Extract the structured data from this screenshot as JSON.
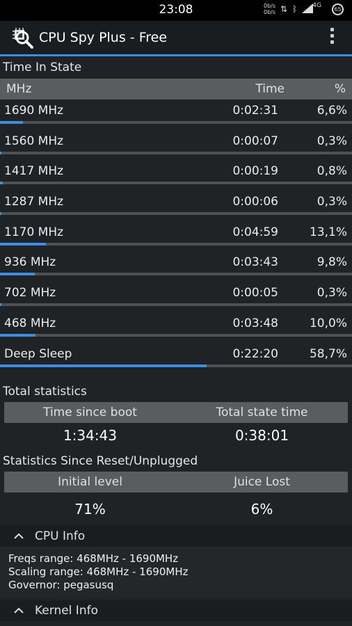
{
  "status": {
    "time": "23:08",
    "net_up": "0b/s",
    "net_down": "0b/s",
    "network": "4G",
    "battery": "65"
  },
  "app": {
    "title": "CPU Spy Plus - Free"
  },
  "time_in_state": {
    "title": "Time In State",
    "headers": {
      "mhz": "MHz",
      "time": "Time",
      "pct": "%"
    },
    "rows": [
      {
        "freq": "1690 MHz",
        "time": "0:02:31",
        "pct": "6,6%",
        "fill": 0.066
      },
      {
        "freq": "1560 MHz",
        "time": "0:00:07",
        "pct": "0,3%",
        "fill": 0.003
      },
      {
        "freq": "1417 MHz",
        "time": "0:00:19",
        "pct": "0,8%",
        "fill": 0.008
      },
      {
        "freq": "1287 MHz",
        "time": "0:00:06",
        "pct": "0,3%",
        "fill": 0.003
      },
      {
        "freq": "1170 MHz",
        "time": "0:04:59",
        "pct": "13,1%",
        "fill": 0.131
      },
      {
        "freq": "936 MHz",
        "time": "0:03:43",
        "pct": "9,8%",
        "fill": 0.098
      },
      {
        "freq": "702 MHz",
        "time": "0:00:05",
        "pct": "0,3%",
        "fill": 0.003
      },
      {
        "freq": "468 MHz",
        "time": "0:03:48",
        "pct": "10,0%",
        "fill": 0.1
      },
      {
        "freq": "Deep Sleep",
        "time": "0:22:20",
        "pct": "58,7%",
        "fill": 0.587
      }
    ]
  },
  "total_stats": {
    "title": "Total statistics",
    "col1": "Time since boot",
    "col2": "Total state time",
    "val1": "1:34:43",
    "val2": "0:38:01"
  },
  "reset_stats": {
    "title": "Statistics Since Reset/Unplugged",
    "col1": "Initial level",
    "col2": "Juice Lost",
    "val1": "71%",
    "val2": "6%"
  },
  "cpu_info": {
    "title": "CPU Info",
    "lines": [
      "Freqs range: 468MHz - 1690MHz",
      "Scaling range: 468MHz - 1690MHz",
      "Governor: pegasusq"
    ]
  },
  "kernel_info": {
    "title": "Kernel Info"
  },
  "colors": {
    "accent": "#3a8ee6",
    "header_bg": "#595d60",
    "bg": "#1f2326"
  }
}
